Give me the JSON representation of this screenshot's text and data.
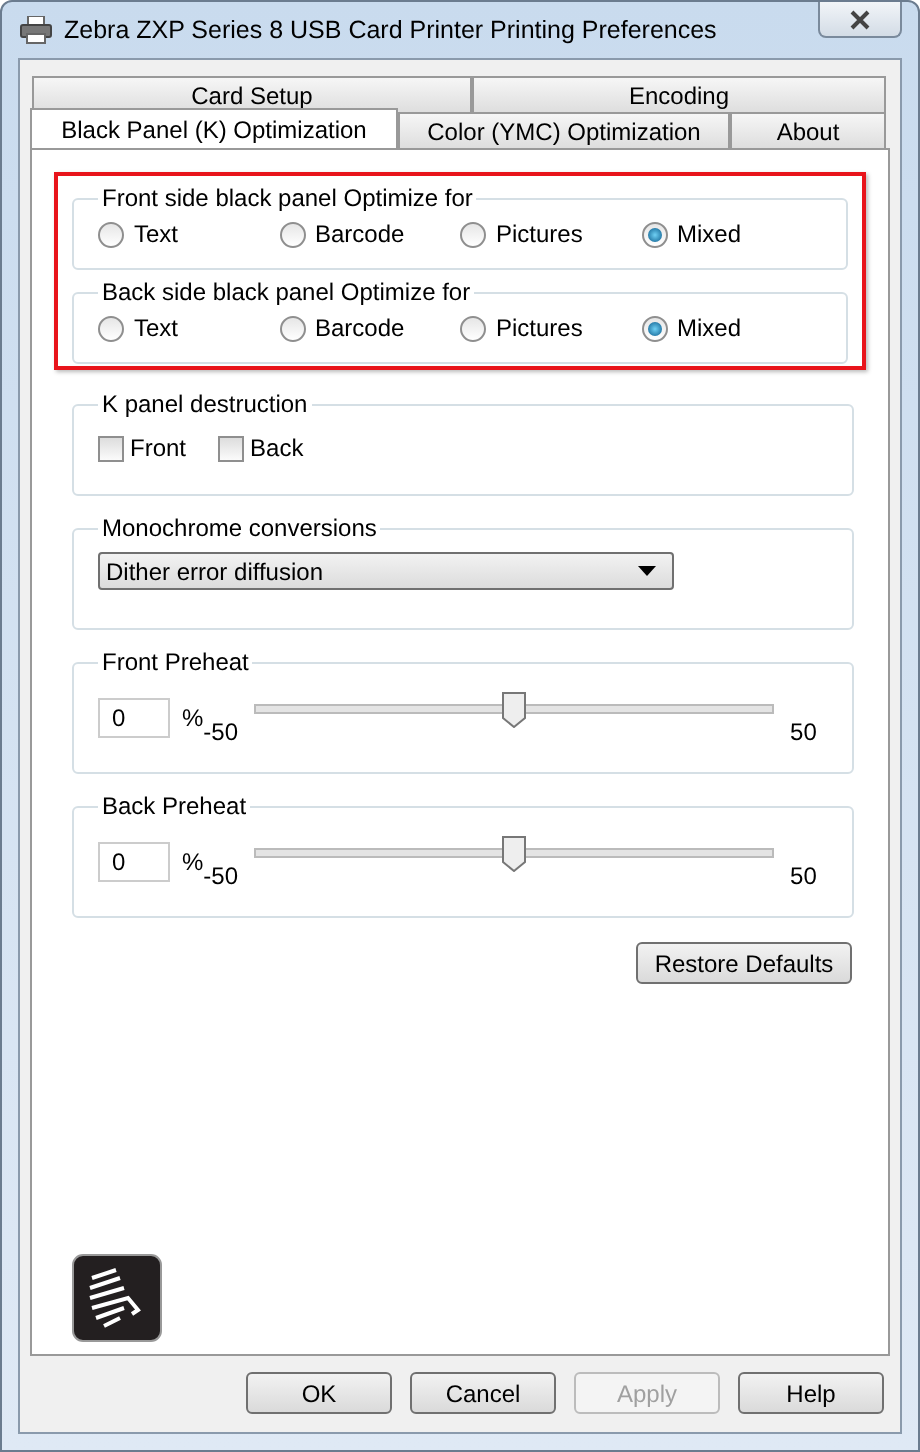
{
  "window": {
    "title": "Zebra ZXP Series 8 USB Card Printer Printing Preferences"
  },
  "tab_rows": [
    {
      "tabs": [
        {
          "label": "Card Setup",
          "selected": false
        },
        {
          "label": "Encoding",
          "selected": false
        }
      ]
    },
    {
      "tabs": [
        {
          "label": "Black Panel (K) Optimization",
          "selected": true
        },
        {
          "label": "Color (YMC) Optimization",
          "selected": false
        },
        {
          "label": "About",
          "selected": false
        }
      ]
    }
  ],
  "radio_groups": [
    {
      "title": "Front side black panel Optimize for",
      "options": [
        {
          "label": "Text",
          "selected": false
        },
        {
          "label": "Barcode",
          "selected": false
        },
        {
          "label": "Pictures",
          "selected": false
        },
        {
          "label": "Mixed",
          "selected": true
        }
      ]
    },
    {
      "title": "Back side black panel Optimize for",
      "options": [
        {
          "label": "Text",
          "selected": false
        },
        {
          "label": "Barcode",
          "selected": false
        },
        {
          "label": "Pictures",
          "selected": false
        },
        {
          "label": "Mixed",
          "selected": true
        }
      ]
    }
  ],
  "k_panel_destruction": {
    "title": "K panel destruction",
    "checkboxes": [
      {
        "label": "Front",
        "checked": false
      },
      {
        "label": "Back",
        "checked": false
      }
    ]
  },
  "monochrome": {
    "title": "Monochrome conversions",
    "value": "Dither error diffusion"
  },
  "preheats": [
    {
      "title": "Front Preheat",
      "value": "0",
      "unit": "%",
      "min_label": "-50",
      "max_label": "50",
      "level": 0.5
    },
    {
      "title": "Back Preheat",
      "value": "0",
      "unit": "%",
      "min_label": "-50",
      "max_label": "50",
      "level": 0.5
    }
  ],
  "restore_button": "Restore Defaults",
  "buttons": [
    {
      "label": "OK",
      "disabled": false
    },
    {
      "label": "Cancel",
      "disabled": false
    },
    {
      "label": "Apply",
      "disabled": true
    },
    {
      "label": "Help",
      "disabled": false
    }
  ]
}
